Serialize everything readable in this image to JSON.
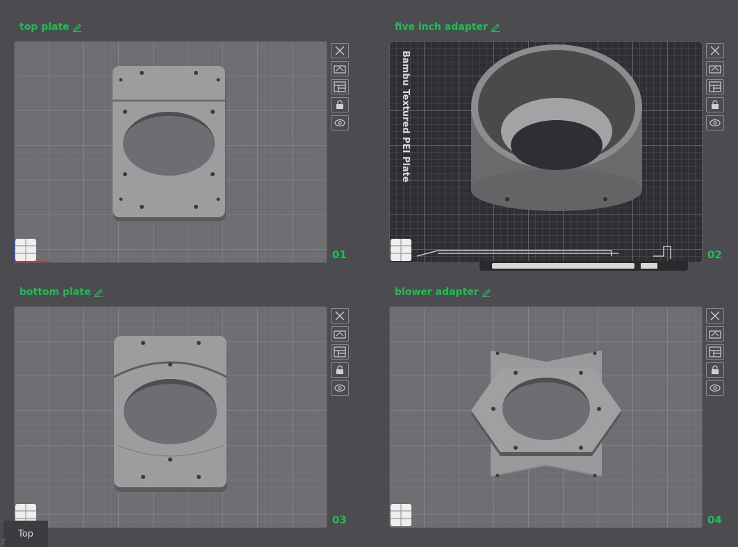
{
  "plates": [
    {
      "title": "top plate",
      "number": "01"
    },
    {
      "title": "five inch adapter",
      "number": "02",
      "plate_label": "Bambu Textured PEI Plate"
    },
    {
      "title": "bottom plate",
      "number": "03"
    },
    {
      "title": "blower adapter",
      "number": "04"
    }
  ],
  "toolbar_icons": [
    "close-icon",
    "auto-orient-icon",
    "arrange-icon",
    "lock-icon",
    "eye-icon"
  ],
  "view": {
    "label": "Top",
    "axis_label": "Z"
  },
  "colors": {
    "accent": "#17c34f",
    "background": "#4b4b50",
    "plate": "#6e6e72",
    "textured_plate": "#2f2f33",
    "model": "#9d9d9f"
  }
}
